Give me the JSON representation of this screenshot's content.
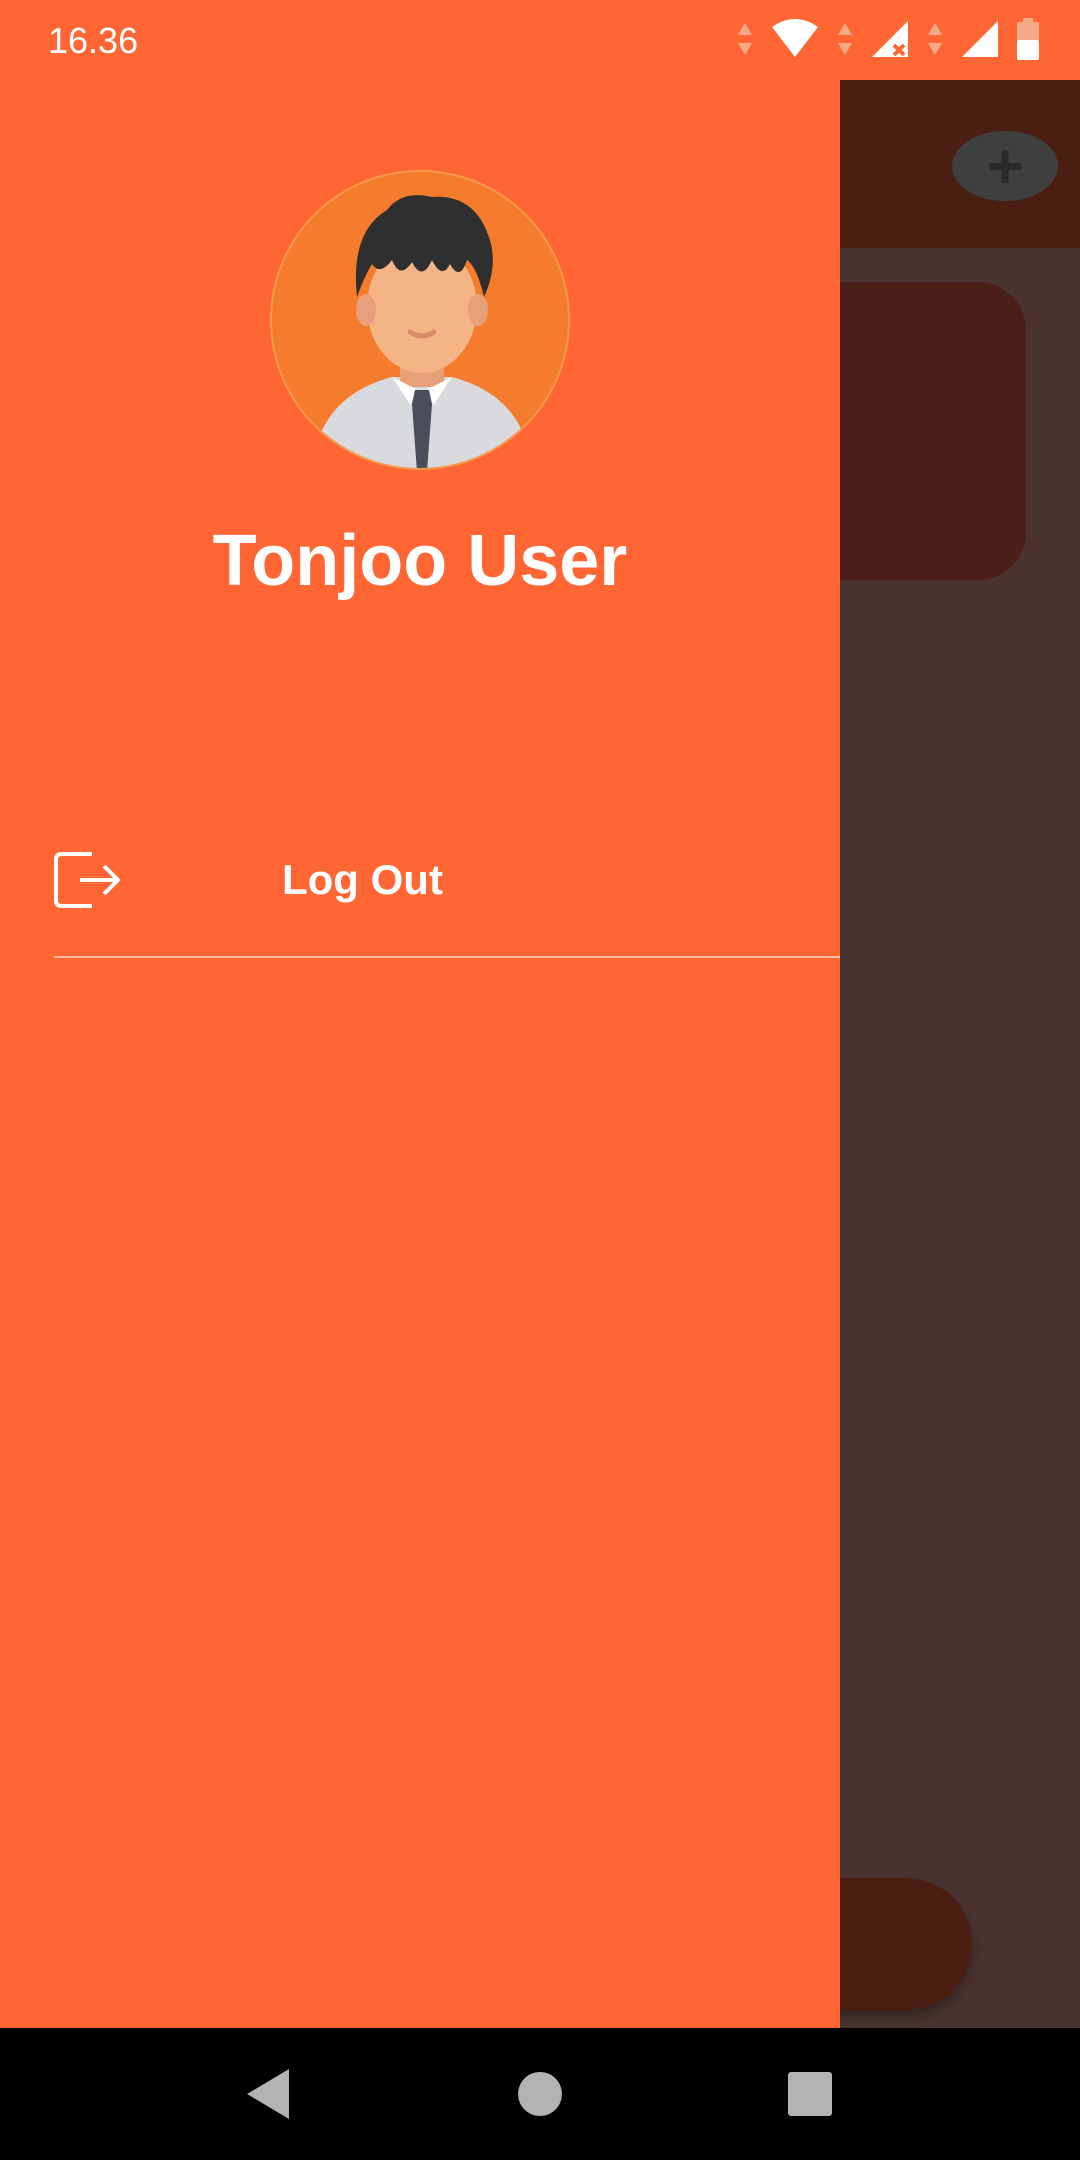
{
  "status_bar": {
    "time": "16.36",
    "icons": [
      "data-arrows-icon",
      "wifi-icon",
      "signal-no-service-icon",
      "signal-icon",
      "battery-icon"
    ]
  },
  "drawer": {
    "user_name": "Tonjoo User",
    "avatar_icon": "user-avatar",
    "menu_items": [
      {
        "label": "Log Out",
        "icon": "logout-icon"
      }
    ]
  },
  "background_app": {
    "add_button_icon": "plus-icon"
  },
  "nav_bar": {
    "buttons": [
      "back-icon",
      "home-icon",
      "recents-icon"
    ]
  },
  "colors": {
    "accent": "#ff6633",
    "app_bar_dim": "#4a1f12",
    "scrim": "#4b3330",
    "nav_bar": "#000000"
  }
}
